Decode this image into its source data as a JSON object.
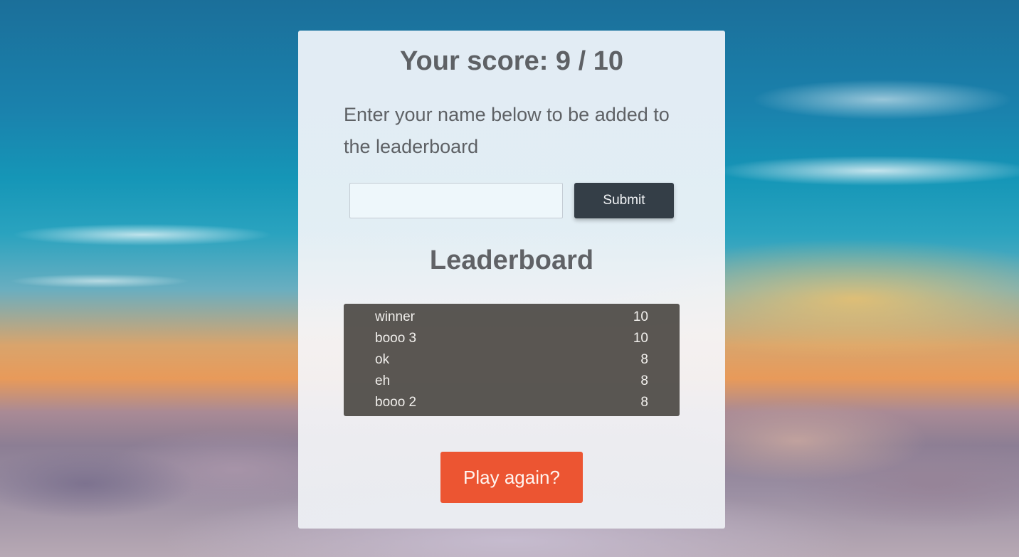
{
  "score": {
    "title": "Your score: 9 / 10"
  },
  "signup": {
    "prompt": "Enter your name below to be added to the leaderboard",
    "name_value": "",
    "submit_label": "Submit"
  },
  "leaderboard": {
    "title": "Leaderboard",
    "entries": [
      {
        "name": "winner",
        "score": "10"
      },
      {
        "name": "booo 3",
        "score": "10"
      },
      {
        "name": "ok",
        "score": "8"
      },
      {
        "name": "eh",
        "score": "8"
      },
      {
        "name": "booo 2",
        "score": "8"
      }
    ]
  },
  "actions": {
    "play_again_label": "Play again?"
  },
  "colors": {
    "submit_bg": "#343e47",
    "play_again_bg": "#ec5532",
    "leaderboard_bg": "#4e4a46"
  }
}
